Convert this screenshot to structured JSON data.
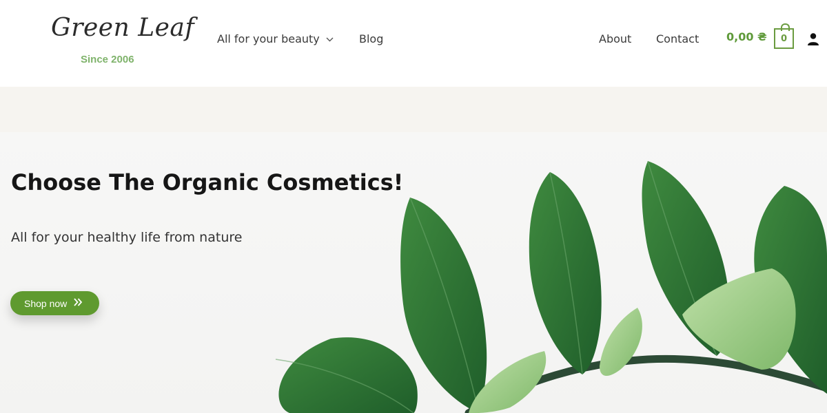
{
  "logo": {
    "script_text": "Green Leaf",
    "tagline": "Since 2006"
  },
  "nav": {
    "beauty_label": "All for your beauty",
    "blog_label": "Blog",
    "about_label": "About",
    "contact_label": "Contact"
  },
  "cart": {
    "total": "0,00 ₴",
    "count": "0"
  },
  "hero": {
    "title": "Choose The Organic Cosmetics!",
    "subtitle": "All for your healthy life from nature",
    "button_label": "Shop now"
  },
  "colors": {
    "brand_green": "#5f9a2f",
    "tagline_green": "#7fb36b",
    "band_beige": "#f6f4f0"
  },
  "icons": [
    "chevron-down-icon",
    "shopping-bag-icon",
    "user-icon",
    "double-chevron-right-icon"
  ]
}
